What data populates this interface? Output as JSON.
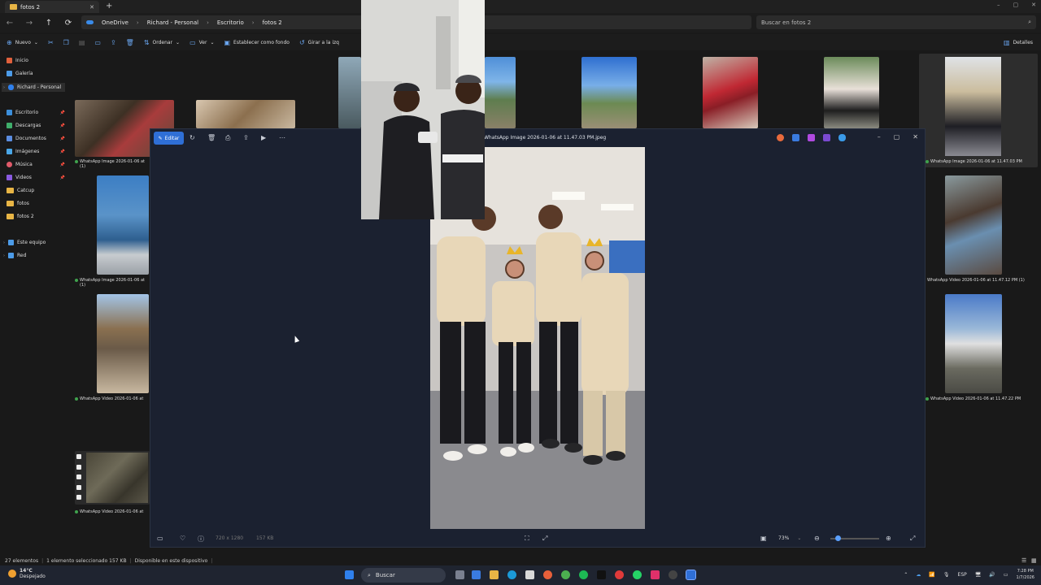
{
  "tab": {
    "title": "fotos 2",
    "close": "✕",
    "new_tab": "+"
  },
  "window_controls": {
    "minimize": "–",
    "maximize": "▢",
    "close": "✕"
  },
  "nav_buttons": {
    "back": "←",
    "forward": "→",
    "up": "↑",
    "refresh": "⟳"
  },
  "breadcrumb": [
    "OneDrive",
    "Richard - Personal",
    "Escritorio",
    "fotos 2"
  ],
  "search": {
    "placeholder": "Buscar en fotos 2",
    "icon": "search-icon"
  },
  "commandbar": {
    "new": "Nuevo",
    "sort": "Ordenar",
    "view": "Ver",
    "set_background": "Establecer como fondo",
    "rotate": "Girar a la izq",
    "details": "Detalles"
  },
  "navpane": {
    "items": [
      {
        "label": "Inicio",
        "color": "#e0603c"
      },
      {
        "label": "Galería",
        "color": "#4c9be8"
      },
      {
        "label": "Richard - Personal",
        "color": "#2f80ed"
      },
      {
        "label": "Escritorio",
        "color": "#3c8fdc"
      },
      {
        "label": "Descargas",
        "color": "#3fae6b"
      },
      {
        "label": "Documentos",
        "color": "#5b8de0"
      },
      {
        "label": "Imágenes",
        "color": "#4aa7e8"
      },
      {
        "label": "Música",
        "color": "#e05a6a"
      },
      {
        "label": "Videos",
        "color": "#8a5ae0"
      },
      {
        "label": "Catcup",
        "color": "#e8b545"
      },
      {
        "label": "fotos",
        "color": "#e8b545"
      },
      {
        "label": "fotos 2",
        "color": "#e8b545"
      },
      {
        "label": "Este equipo",
        "color": "#4c9be8"
      },
      {
        "label": "Red",
        "color": "#4c9be8"
      }
    ]
  },
  "files": [
    {
      "caption": "WhatsApp Image 2026-01-06 at",
      "sub": "(1)"
    },
    {
      "caption": "WhatsApp Image 2026-01-06 at",
      "sub": "(1)"
    },
    {
      "caption": "WhatsApp Video 2026-01-06 at",
      "sub": ""
    },
    {
      "caption": "WhatsApp Video 2026-01-06 at",
      "sub": ""
    },
    {
      "caption": "WhatsApp Image 2026-01-06 at 11.47.03 PM",
      "sub": ""
    },
    {
      "caption": "WhatsApp Video 2026-01-06 at 11.47.12 PM (1)",
      "sub": ""
    },
    {
      "caption": "WhatsApp Video 2026-01-06 at 11.47.22 PM",
      "sub": ""
    }
  ],
  "viewer": {
    "edit_label": "Editar",
    "title": "WhatsApp Image 2026-01-06 at 11.47.03 PM.jpeg",
    "dimensions": "720 x 1280",
    "filesize": "157 KB",
    "zoom": "73%",
    "zoom_level": 0.15
  },
  "statusbar": {
    "count": "27 elementos",
    "selected": "1 elemento seleccionado  157 KB",
    "availability": "Disponible en este dispositivo"
  },
  "taskbar": {
    "temperature": "14°C",
    "weather": "Despejado",
    "search": "Buscar",
    "language": "ESP",
    "time": "7:28 PM",
    "date": "1/7/2026"
  }
}
